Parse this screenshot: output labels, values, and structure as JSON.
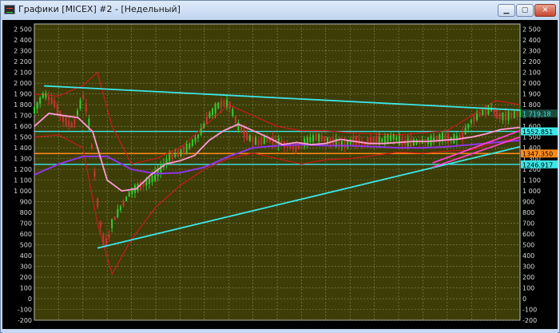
{
  "window": {
    "title": "Графики [MICEX] #2 - [Недельный]",
    "controls": {
      "minimize": "▁",
      "maximize": "▢",
      "close": "✕"
    },
    "icon": "chart-app-icon"
  },
  "chart_data": {
    "type": "line",
    "title": "",
    "xlabel": "",
    "ylabel": "",
    "ylim": [
      -200,
      2550
    ],
    "y_ticks": [
      2500,
      2400,
      2300,
      2200,
      2100,
      2000,
      1900,
      1800,
      1700,
      1600,
      1500,
      1400,
      1300,
      1200,
      1100,
      1000,
      900,
      800,
      700,
      600,
      500,
      400,
      300,
      200,
      100,
      0,
      -100,
      -200
    ],
    "tick_labels": [
      "2 500",
      "2 400",
      "2 300",
      "2 200",
      "2 100",
      "2 000",
      "1 900",
      "1 800",
      "1 700",
      "1 600",
      "1 500",
      "1 400",
      "1 300",
      "1 200",
      "1 100",
      "1 000",
      "900",
      "800",
      "700",
      "600",
      "500",
      "400",
      "300",
      "200",
      "100",
      "0",
      "-100",
      "-200"
    ],
    "right_tick_labels": [
      "2 500",
      "2 400",
      "2 300",
      "2 200",
      "2 100",
      "2 000",
      "1 900",
      "1 800",
      "1 700",
      "1 600",
      "1 500",
      "1 400",
      "1 300",
      "1 200",
      "1 100",
      "1 000",
      "900",
      "800",
      "700",
      "600",
      "500",
      "400",
      "300",
      "200",
      "100",
      "0",
      "-100",
      "-200"
    ],
    "grid": true,
    "colors": {
      "background": "#3d3d07",
      "grid": "#8a8a5a",
      "candles_up": "#33cc33",
      "candles_down": "#cc3333",
      "ma_pink": "#ff9ad5",
      "ma_violet": "#8f36e8",
      "band": "#cc1a1a",
      "trend": "#3de6e6"
    },
    "price_labels": [
      {
        "value": 1719.18,
        "text": "1 719,18",
        "color": "#3de6e6",
        "bg": "#1d4a3a"
      },
      {
        "value": 1552.85,
        "text": "1552.851",
        "color": "#000000",
        "bg": "#3de6e6"
      },
      {
        "value": 1347.35,
        "text": "1347.350",
        "color": "#000000",
        "bg": "#ff8c1a"
      },
      {
        "value": 1246.91,
        "text": "1246.917",
        "color": "#000000",
        "bg": "#3de6e6"
      }
    ],
    "horizontal_levels": [
      {
        "value": 1552.85,
        "color": "#3de6e6"
      },
      {
        "value": 1347.35,
        "color": "#ff8c1a"
      },
      {
        "value": 1246.91,
        "color": "#3de6e6"
      }
    ],
    "trendlines": [
      {
        "from": [
          0.02,
          1975
        ],
        "to": [
          1.0,
          1750
        ],
        "color": "#3de6e6"
      },
      {
        "from": [
          0.13,
          470
        ],
        "to": [
          1.0,
          1410
        ],
        "color": "#3de6e6"
      },
      {
        "from": [
          0.82,
          1220
        ],
        "to": [
          1.0,
          1500
        ],
        "color": "#ff3fd0"
      },
      {
        "from": [
          0.82,
          1260
        ],
        "to": [
          1.0,
          1560
        ],
        "color": "#ff3fd0"
      }
    ],
    "series": [
      {
        "x": [
          0,
          0.02,
          0.04,
          0.06,
          0.08,
          0.1,
          0.11,
          0.12,
          0.13,
          0.14,
          0.15,
          0.16,
          0.18,
          0.2,
          0.22,
          0.24,
          0.26,
          0.28,
          0.3,
          0.32,
          0.34,
          0.36,
          0.38,
          0.4,
          0.42,
          0.44,
          0.46,
          0.48,
          0.5,
          0.52,
          0.54,
          0.56,
          0.58,
          0.6,
          0.62,
          0.64,
          0.66,
          0.68,
          0.7,
          0.72,
          0.74,
          0.76,
          0.78,
          0.8,
          0.82,
          0.84,
          0.86,
          0.88,
          0.9,
          0.92,
          0.94,
          0.96,
          0.98,
          1.0
        ],
        "values": [
          1750,
          1900,
          1820,
          1660,
          1600,
          1880,
          1720,
          1350,
          900,
          560,
          510,
          700,
          860,
          1000,
          1050,
          1100,
          1200,
          1320,
          1350,
          1420,
          1520,
          1700,
          1800,
          1820,
          1600,
          1500,
          1450,
          1480,
          1460,
          1420,
          1400,
          1460,
          1500,
          1480,
          1450,
          1430,
          1470,
          1440,
          1480,
          1470,
          1500,
          1450,
          1450,
          1460,
          1470,
          1500,
          1480,
          1500,
          1650,
          1720,
          1760,
          1690,
          1700,
          1720
        ]
      },
      {
        "name": "",
        "x": [
          0,
          0.03,
          0.06,
          0.09,
          0.12,
          0.15,
          0.18,
          0.21,
          0.24,
          0.27,
          0.3,
          0.33,
          0.36,
          0.39,
          0.42,
          0.45,
          0.48,
          0.51,
          0.54,
          0.57,
          0.6,
          0.63,
          0.66,
          0.69,
          0.72,
          0.75,
          0.78,
          0.81,
          0.84,
          0.87,
          0.9,
          0.93,
          0.96,
          1.0
        ],
        "values": [
          1600,
          1720,
          1700,
          1680,
          1550,
          1100,
          1000,
          1020,
          1150,
          1250,
          1280,
          1330,
          1470,
          1560,
          1620,
          1560,
          1500,
          1430,
          1450,
          1430,
          1440,
          1480,
          1460,
          1440,
          1440,
          1450,
          1460,
          1460,
          1470,
          1480,
          1500,
          1530,
          1570,
          1590
        ]
      },
      {
        "name": "",
        "x": [
          0,
          0.05,
          0.1,
          0.15,
          0.2,
          0.25,
          0.3,
          0.35,
          0.4,
          0.45,
          0.5,
          0.55,
          0.6,
          0.65,
          0.7,
          0.75,
          0.8,
          0.85,
          0.9,
          0.95,
          1.0
        ],
        "values": [
          1150,
          1250,
          1320,
          1320,
          1200,
          1160,
          1170,
          1220,
          1320,
          1400,
          1420,
          1430,
          1420,
          1420,
          1410,
          1400,
          1400,
          1410,
          1430,
          1450,
          1470
        ]
      }
    ],
    "band_upper": {
      "x": [
        0,
        0.05,
        0.1,
        0.13,
        0.16,
        0.2,
        0.25,
        0.3,
        0.35,
        0.4,
        0.45,
        0.5,
        0.55,
        0.6,
        0.65,
        0.7,
        0.75,
        0.8,
        0.85,
        0.9,
        0.95,
        1.0
      ],
      "values": [
        1900,
        1880,
        1980,
        2100,
        1600,
        1250,
        1300,
        1400,
        1600,
        1800,
        1700,
        1600,
        1560,
        1560,
        1540,
        1530,
        1520,
        1540,
        1560,
        1700,
        1840,
        1800
      ]
    },
    "band_lower": {
      "x": [
        0,
        0.05,
        0.1,
        0.13,
        0.16,
        0.2,
        0.25,
        0.3,
        0.35,
        0.4,
        0.45,
        0.5,
        0.55,
        0.6,
        0.65,
        0.7,
        0.75,
        0.8,
        0.85,
        0.9,
        0.95,
        1.0
      ],
      "values": [
        1500,
        1520,
        1400,
        700,
        230,
        550,
        850,
        1050,
        1200,
        1300,
        1350,
        1300,
        1250,
        1290,
        1300,
        1330,
        1360,
        1350,
        1370,
        1380,
        1450,
        1500
      ]
    }
  }
}
